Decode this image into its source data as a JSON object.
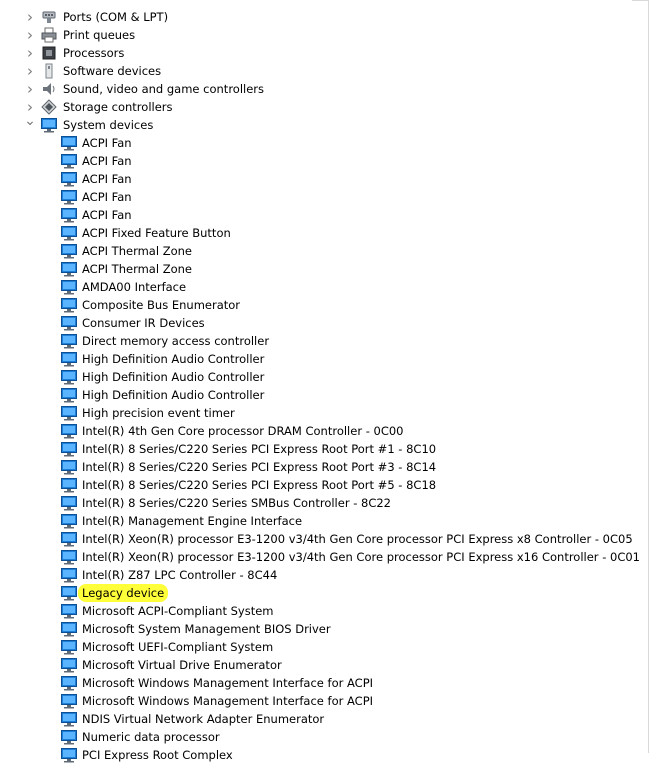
{
  "categories": [
    {
      "label": "Ports (COM & LPT)",
      "icon": "port-icon",
      "expanded": false
    },
    {
      "label": "Print queues",
      "icon": "printer-icon",
      "expanded": false
    },
    {
      "label": "Processors",
      "icon": "processor-icon",
      "expanded": false
    },
    {
      "label": "Software devices",
      "icon": "software-device-icon",
      "expanded": false
    },
    {
      "label": "Sound, video and game controllers",
      "icon": "speaker-icon",
      "expanded": false
    },
    {
      "label": "Storage controllers",
      "icon": "storage-controller-icon",
      "expanded": false
    },
    {
      "label": "System devices",
      "icon": "monitor-icon",
      "expanded": true
    }
  ],
  "system_devices": [
    {
      "label": "ACPI Fan",
      "icon": "monitor-icon"
    },
    {
      "label": "ACPI Fan",
      "icon": "monitor-icon"
    },
    {
      "label": "ACPI Fan",
      "icon": "monitor-icon"
    },
    {
      "label": "ACPI Fan",
      "icon": "monitor-icon"
    },
    {
      "label": "ACPI Fan",
      "icon": "monitor-icon"
    },
    {
      "label": "ACPI Fixed Feature Button",
      "icon": "monitor-icon"
    },
    {
      "label": "ACPI Thermal Zone",
      "icon": "monitor-icon"
    },
    {
      "label": "ACPI Thermal Zone",
      "icon": "monitor-icon"
    },
    {
      "label": "AMDA00 Interface",
      "icon": "monitor-icon"
    },
    {
      "label": "Composite Bus Enumerator",
      "icon": "monitor-icon"
    },
    {
      "label": "Consumer IR Devices",
      "icon": "monitor-icon"
    },
    {
      "label": "Direct memory access controller",
      "icon": "monitor-icon"
    },
    {
      "label": "High Definition Audio Controller",
      "icon": "monitor-icon"
    },
    {
      "label": "High Definition Audio Controller",
      "icon": "monitor-icon"
    },
    {
      "label": "High Definition Audio Controller",
      "icon": "monitor-icon"
    },
    {
      "label": "High precision event timer",
      "icon": "monitor-icon"
    },
    {
      "label": "Intel(R) 4th Gen Core processor DRAM Controller - 0C00",
      "icon": "monitor-icon"
    },
    {
      "label": "Intel(R) 8 Series/C220 Series  PCI Express Root Port #1 - 8C10",
      "icon": "monitor-icon"
    },
    {
      "label": "Intel(R) 8 Series/C220 Series  PCI Express Root Port #3 - 8C14",
      "icon": "monitor-icon"
    },
    {
      "label": "Intel(R) 8 Series/C220 Series  PCI Express Root Port #5 - 8C18",
      "icon": "monitor-icon"
    },
    {
      "label": "Intel(R) 8 Series/C220 Series  SMBus Controller - 8C22",
      "icon": "monitor-icon"
    },
    {
      "label": "Intel(R) Management Engine Interface",
      "icon": "monitor-icon"
    },
    {
      "label": "Intel(R) Xeon(R) processor E3-1200 v3/4th Gen Core processor PCI Express x8 Controller - 0C05",
      "icon": "monitor-icon"
    },
    {
      "label": "Intel(R) Xeon(R) processor E3-1200 v3/4th Gen Core processor PCI Express x16 Controller - 0C01",
      "icon": "monitor-icon"
    },
    {
      "label": "Intel(R) Z87 LPC Controller - 8C44",
      "icon": "monitor-icon"
    },
    {
      "label": "Legacy device",
      "icon": "monitor-icon",
      "highlighted": true
    },
    {
      "label": "Microsoft ACPI-Compliant System",
      "icon": "monitor-icon"
    },
    {
      "label": "Microsoft System Management BIOS Driver",
      "icon": "monitor-icon"
    },
    {
      "label": "Microsoft UEFI-Compliant System",
      "icon": "monitor-icon"
    },
    {
      "label": "Microsoft Virtual Drive Enumerator",
      "icon": "monitor-icon"
    },
    {
      "label": "Microsoft Windows Management Interface for ACPI",
      "icon": "monitor-icon"
    },
    {
      "label": "Microsoft Windows Management Interface for ACPI",
      "icon": "monitor-icon"
    },
    {
      "label": "NDIS Virtual Network Adapter Enumerator",
      "icon": "monitor-icon"
    },
    {
      "label": "Numeric data processor",
      "icon": "monitor-icon"
    },
    {
      "label": "PCI Express Root Complex",
      "icon": "monitor-icon"
    }
  ],
  "colors": {
    "highlight": "#ffff3a",
    "monitor_blue": "#1e7fd8",
    "chevron": "#7a7a7a"
  }
}
